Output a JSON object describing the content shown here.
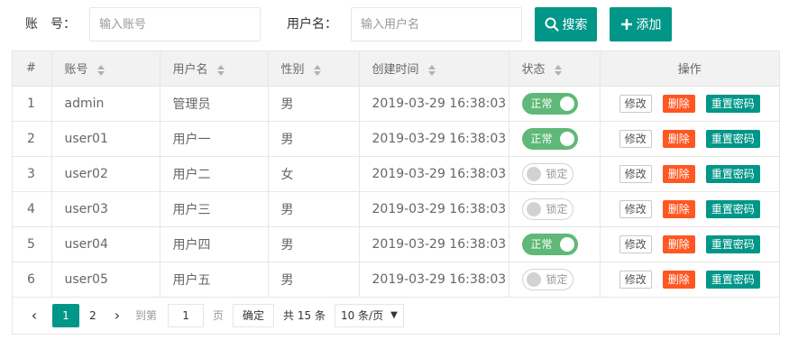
{
  "search": {
    "account_label": "账　号：",
    "account_placeholder": "输入账号",
    "username_label": "用户名：",
    "username_placeholder": "输入用户名",
    "search_button": "搜索",
    "add_button": "添加"
  },
  "table": {
    "headers": [
      "#",
      "账号",
      "用户名",
      "性别",
      "创建时间",
      "状态",
      "操作"
    ],
    "rows": [
      {
        "idx": "1",
        "account": "admin",
        "name": "管理员",
        "gender": "男",
        "created": "2019-03-29 16:38:03",
        "status": "正常"
      },
      {
        "idx": "2",
        "account": "user01",
        "name": "用户一",
        "gender": "男",
        "created": "2019-03-29 16:38:03",
        "status": "正常"
      },
      {
        "idx": "3",
        "account": "user02",
        "name": "用户二",
        "gender": "女",
        "created": "2019-03-29 16:38:03",
        "status": "锁定"
      },
      {
        "idx": "4",
        "account": "user03",
        "name": "用户三",
        "gender": "男",
        "created": "2019-03-29 16:38:03",
        "status": "锁定"
      },
      {
        "idx": "5",
        "account": "user04",
        "name": "用户四",
        "gender": "男",
        "created": "2019-03-29 16:38:03",
        "status": "正常"
      },
      {
        "idx": "6",
        "account": "user05",
        "name": "用户五",
        "gender": "男",
        "created": "2019-03-29 16:38:03",
        "status": "锁定"
      }
    ],
    "actions": {
      "edit": "修改",
      "delete": "删除",
      "reset": "重置密码"
    }
  },
  "pager": {
    "prev_icon": "‹",
    "next_icon": "›",
    "pages": [
      "1",
      "2"
    ],
    "goto_label": "到第",
    "goto_value": "1",
    "page_label": "页",
    "confirm": "确定",
    "total": "共 15 条",
    "page_size": "10 条/页"
  },
  "colors": {
    "primary": "#009688",
    "switch_on": "#5fb878",
    "danger": "#ff5722"
  }
}
